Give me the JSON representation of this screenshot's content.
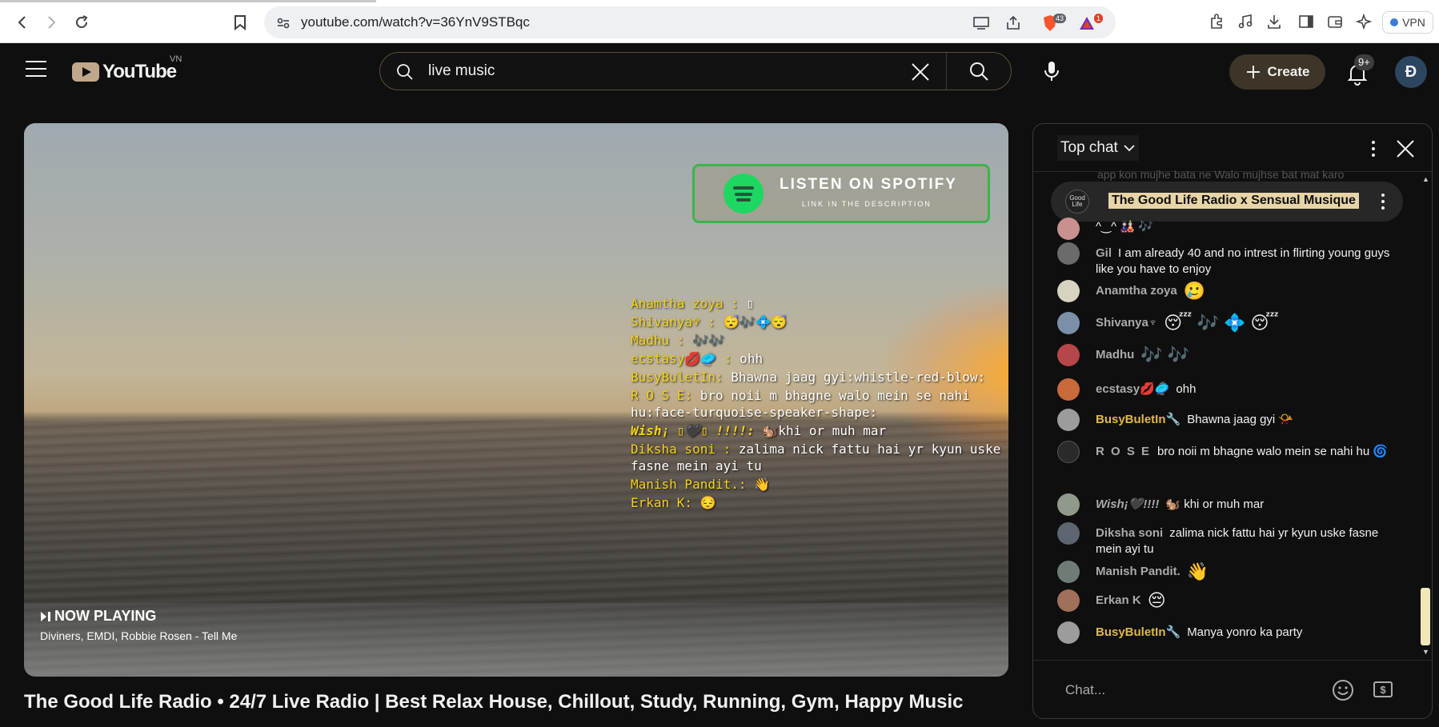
{
  "browser": {
    "url": "youtube.com/watch?v=36YnV9STBqc",
    "brave_badge": "43",
    "rewards_badge": "1",
    "vpn_label": "VPN"
  },
  "header": {
    "logo_text": "YouTube",
    "country_code": "VN",
    "search_value": "live music",
    "create_label": "Create",
    "notifications_badge": "9+",
    "avatar_letter": "Đ"
  },
  "player": {
    "spotify_title": "LISTEN ON SPOTIFY",
    "spotify_sub": "LINK IN THE DESCRIPTION",
    "now_playing_label": "NOW PLAYING",
    "now_playing_track": "Diviners, EMDI, Robbie Rosen - Tell Me",
    "overlay": [
      {
        "name": "Anamtha zoya :",
        "text": " ▯"
      },
      {
        "name": "Shivanya♆ :",
        "text": " 😴🎶💠😴"
      },
      {
        "name": "Madhu :",
        "text": " 🎶🎶"
      },
      {
        "name": "ecstasy💋🥏 :",
        "text": " ohh"
      },
      {
        "name": "BusyBuletIn:",
        "text": " Bhawna jaag gyi:whistle-red-blow:"
      },
      {
        "name": "R O S E:",
        "text": " bro noii m bhagne walo mein se nahi hu:face-turquoise-speaker-shape:"
      },
      {
        "name": "Wish¡ ▯🖤▯ !!!!:",
        "text": " 🐿️khi or muh mar"
      },
      {
        "name": "Diksha soni :",
        "text": " zalima nick fattu hai yr kyun uske fasne mein ayi tu"
      },
      {
        "name": "Manish Pandit.:",
        "text": " 👋"
      },
      {
        "name": "Erkan K:",
        "text": " 😔"
      }
    ]
  },
  "video": {
    "title": "The Good Life Radio • 24/7 Live Radio | Best Relax House, Chillout, Study, Running, Gym, Happy Music"
  },
  "chat": {
    "mode_label": "Top chat",
    "ticker_name": "The Good Life Radio x Sensual Musique",
    "ticker_avatar_text": "Good Life",
    "cut_line": "app kon mujhe bata ne Walo mujhse bat mat karo",
    "partial_line": "^‿^ 🎎 🎶",
    "placeholder": "Chat...",
    "messages": [
      {
        "author": "Gil",
        "text": "I am already 40 and no intrest in flirting young guys like you have to enjoy",
        "gold": false,
        "avatar_color": "#6b6b6b"
      },
      {
        "author": "Anamtha zoya",
        "text": "🥲",
        "gold": false,
        "avatar_color": "#d8d2c0"
      },
      {
        "author": "Shivanya♆",
        "text": "😴 🎶 💠 😴",
        "gold": false,
        "avatar_color": "#7b8fa8"
      },
      {
        "author": "Madhu",
        "text": "🎶 🎶",
        "gold": false,
        "avatar_color": "#b5474a"
      },
      {
        "author": "ecstasy💋🥏",
        "text": "ohh",
        "gold": false,
        "avatar_color": "#c96a3a"
      },
      {
        "author": "BusyBuletIn🔧",
        "text": "Bhawna jaag gyi 📯",
        "gold": true,
        "avatar_color": "#9c9c9c"
      },
      {
        "author": "R O S E",
        "text": "bro noii m bhagne walo mein se nahi hu 🌀",
        "gold": false,
        "avatar_color": "#2a2a2a"
      },
      {
        "author": "Wish¡🖤!!!!",
        "text": "🐿️ khi or muh mar",
        "gold": false,
        "avatar_color": "#8f9a8c"
      },
      {
        "author": "Diksha soni",
        "text": "zalima nick fattu hai yr kyun uske fasne mein ayi tu",
        "gold": false,
        "avatar_color": "#5c6570"
      },
      {
        "author": "Manish Pandit.",
        "text": "👋",
        "gold": false,
        "avatar_color": "#6f7c76"
      },
      {
        "author": "Erkan K",
        "text": "😔",
        "gold": false,
        "avatar_color": "#a0705a"
      },
      {
        "author": "BusyBuletIn🔧",
        "text": "Manya yonro ka party",
        "gold": true,
        "avatar_color": "#9c9c9c"
      }
    ]
  }
}
